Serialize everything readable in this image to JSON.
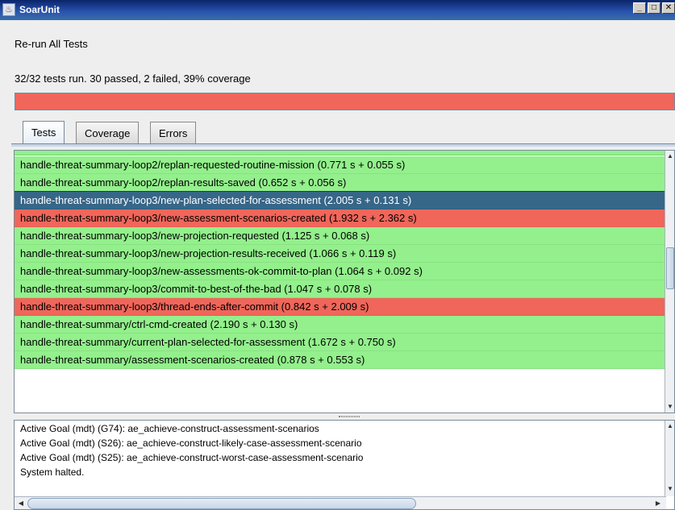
{
  "window": {
    "title": "SoarUnit"
  },
  "toolbar": {
    "rerun_label": "Re-run All Tests"
  },
  "summary": {
    "text": "32/32 tests run. 30 passed, 2 failed, 39% coverage",
    "progress": 1.0
  },
  "colors": {
    "pass": "#93f08c",
    "fail": "#f0665a",
    "selected": "#366688"
  },
  "tabs": [
    {
      "label": "Tests"
    },
    {
      "label": "Coverage"
    },
    {
      "label": "Errors"
    }
  ],
  "tests": [
    {
      "label": "handle-threat-summary-loop2/replan-requested-routine-mission (0.771 s + 0.055 s)",
      "status": "pass"
    },
    {
      "label": "handle-threat-summary-loop2/replan-results-saved (0.652 s + 0.056 s)",
      "status": "pass"
    },
    {
      "label": "handle-threat-summary-loop3/new-plan-selected-for-assessment (2.005 s + 0.131 s)",
      "status": "selected"
    },
    {
      "label": "handle-threat-summary-loop3/new-assessment-scenarios-created (1.932 s + 2.362 s)",
      "status": "fail"
    },
    {
      "label": "handle-threat-summary-loop3/new-projection-requested (1.125 s + 0.068 s)",
      "status": "pass"
    },
    {
      "label": "handle-threat-summary-loop3/new-projection-results-received (1.066 s + 0.119 s)",
      "status": "pass"
    },
    {
      "label": "handle-threat-summary-loop3/new-assessments-ok-commit-to-plan (1.064 s + 0.092 s)",
      "status": "pass"
    },
    {
      "label": "handle-threat-summary-loop3/commit-to-best-of-the-bad (1.047 s + 0.078 s)",
      "status": "pass"
    },
    {
      "label": "handle-threat-summary-loop3/thread-ends-after-commit (0.842 s + 2.009 s)",
      "status": "fail"
    },
    {
      "label": "handle-threat-summary/ctrl-cmd-created (2.190 s + 0.130 s)",
      "status": "pass"
    },
    {
      "label": "handle-threat-summary/current-plan-selected-for-assessment (1.672 s + 0.750 s)",
      "status": "pass"
    },
    {
      "label": "handle-threat-summary/assessment-scenarios-created (0.878 s + 0.553 s)",
      "status": "pass"
    }
  ],
  "log": [
    "Active Goal (mdt) (G74): ae_achieve-construct-assessment-scenarios",
    "Active Goal (mdt) (S26): ae_achieve-construct-likely-case-assessment-scenario",
    "Active Goal (mdt) (S25): ae_achieve-construct-worst-case-assessment-scenario",
    "System halted."
  ]
}
